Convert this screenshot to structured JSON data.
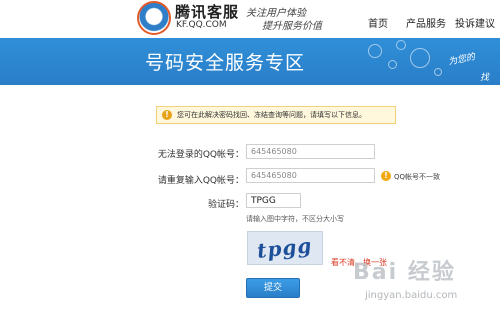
{
  "header": {
    "logo_title": "腾讯客服",
    "logo_subtitle": "KF.QQ.COM",
    "slogan_line1": "关注用户体验",
    "slogan_line2": "提升服务价值",
    "nav": [
      "首页",
      "产品服务",
      "投诉建议"
    ]
  },
  "banner": {
    "title": "号码安全服务专区",
    "right_text_1": "为您的",
    "right_text_2": "找"
  },
  "notice": {
    "text": "您可在此解决密码找回、冻结查询等问题，请填写以下信息。"
  },
  "form": {
    "qq_label": "无法登录的QQ帐号：",
    "qq_value": "645465080",
    "qq_repeat_label": "请重复输入QQ帐号：",
    "qq_repeat_value": "645465080",
    "mismatch_text": "QQ帐号不一致",
    "captcha_label": "验证码：",
    "captcha_value": "TPGG",
    "captcha_hint": "请输入图中字符，不区分大小写",
    "captcha_image_text": "tpgg",
    "refresh_text": "看不清，换一张",
    "submit_label": "提交"
  },
  "watermark": {
    "main": "Bai 经验",
    "sub": "jingyan.baidu.com"
  },
  "colors": {
    "banner_blue": "#2a7ec8",
    "warning_orange": "#f1a814",
    "link_red": "#d9381e"
  }
}
